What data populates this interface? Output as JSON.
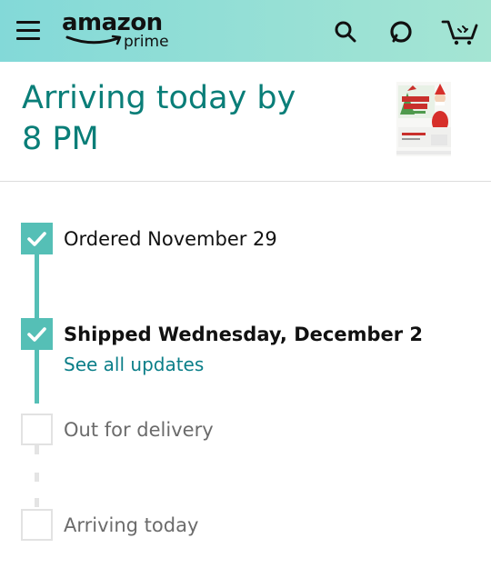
{
  "header": {
    "logo_word": "amazon",
    "logo_sub": "prime",
    "icons": [
      "menu-icon",
      "search-icon",
      "alexa-icon",
      "cart-icon"
    ]
  },
  "delivery": {
    "status_line1": "Arriving today by",
    "status_line2": "8 PM"
  },
  "product": {
    "thumbnail_text": "The ELF on the SHELF"
  },
  "steps": [
    {
      "label": "Ordered November 29",
      "completed": true
    },
    {
      "label": "Shipped Wednesday, December 2",
      "completed": true,
      "link": "See all updates"
    },
    {
      "label": "Out for delivery",
      "completed": false
    },
    {
      "label": "Arriving today",
      "completed": false
    }
  ],
  "colors": {
    "accent": "#55bfb6",
    "title": "#0a7e78",
    "link": "#0a7e88",
    "header_gradient_start": "#83d9d8",
    "header_gradient_end": "#a5e5d3"
  }
}
